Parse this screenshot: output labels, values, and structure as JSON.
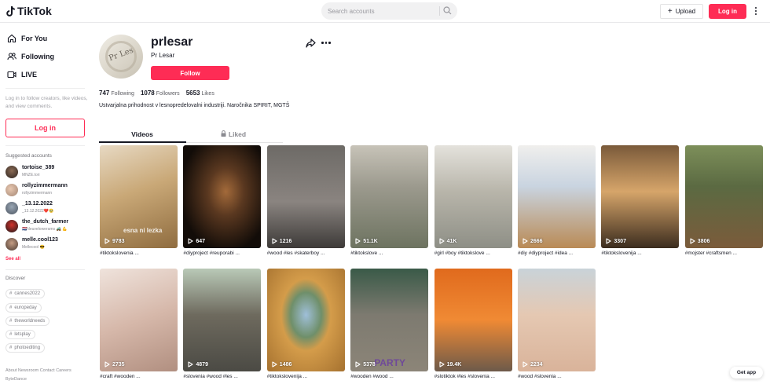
{
  "app": {
    "name": "TikTok",
    "brand_color": "#fe2c55"
  },
  "header": {
    "search_placeholder": "Search accounts",
    "upload_label": "Upload",
    "login_label": "Log in"
  },
  "sidebar": {
    "nav": [
      {
        "label": "For You",
        "icon": "home-icon"
      },
      {
        "label": "Following",
        "icon": "users-icon"
      },
      {
        "label": "LIVE",
        "icon": "live-icon"
      }
    ],
    "login_note": "Log in to follow creators, like videos, and view comments.",
    "login_button": "Log in",
    "suggested_title": "Suggested accounts",
    "suggested": [
      {
        "name": "tortoise_389",
        "sub": "MNZE.tori"
      },
      {
        "name": "rollyzimmermann",
        "sub": "rollyzimmermann"
      },
      {
        "name": "_13.12.2022",
        "sub": "_13.12.2022❤️🥹"
      },
      {
        "name": "the_dutch_farmer",
        "sub": "🇳🇱Neuvelowerams 🚜 💪"
      },
      {
        "name": "melle.cool123",
        "sub": "Mellecool 😎"
      }
    ],
    "see_all": "See all",
    "discover_title": "Discover",
    "discover_tags": [
      "cannes2022",
      "europeday",
      "theworldneeds",
      "letsplay",
      "photoediting"
    ],
    "footer_line1": "About  Newsroom  Contact  Careers",
    "footer_line2": "ByteDance"
  },
  "profile": {
    "username": "prlesar",
    "nickname": "Pr Lesar",
    "follow_label": "Follow",
    "avatar_text": "Pr Les",
    "stats": {
      "following_count": "747",
      "following_label": "Following",
      "followers_count": "1078",
      "followers_label": "Followers",
      "likes_count": "5653",
      "likes_label": "Likes"
    },
    "bio": "Ustvarjalna prihodnost v lesnopredelovalni industriji. Naročnika SPIRIT, MGTŠ",
    "tabs": {
      "videos": "Videos",
      "liked": "Liked"
    }
  },
  "videos": [
    {
      "views": "9783",
      "caption": "#tiktokslovenia ...",
      "overlay": "esna ni lezka"
    },
    {
      "views": "647",
      "caption": "#diyproject #reuporabi ...",
      "overlay": ""
    },
    {
      "views": "1216",
      "caption": "#wood #les #skaterboy ...",
      "overlay": ""
    },
    {
      "views": "51.1K",
      "caption": "#tiktokslove ...",
      "overlay": ""
    },
    {
      "views": "41K",
      "caption": "#girl #boy #tiktokslove ...",
      "overlay": ""
    },
    {
      "views": "2666",
      "caption": "#diy #diyproject #idea ...",
      "overlay": ""
    },
    {
      "views": "3307",
      "caption": "#tiktokslovenija ...",
      "overlay": ""
    },
    {
      "views": "3806",
      "caption": "#mojster #craftsmen ...",
      "overlay": ""
    },
    {
      "views": "2735",
      "caption": "#craft #wooden ...",
      "overlay": ""
    },
    {
      "views": "4879",
      "caption": "#slovenia #wood #les ...",
      "overlay": ""
    },
    {
      "views": "1486",
      "caption": "#tiktokslovenija ...",
      "overlay": ""
    },
    {
      "views": "5378",
      "caption": "#wooden #wood ...",
      "overlay": "PARTY"
    },
    {
      "views": "19.4K",
      "caption": "#slotiktok #les #slovenia ...",
      "overlay": ""
    },
    {
      "views": "2234",
      "caption": "#wood #slovenia ...",
      "overlay": ""
    }
  ],
  "get_app": "Get app"
}
